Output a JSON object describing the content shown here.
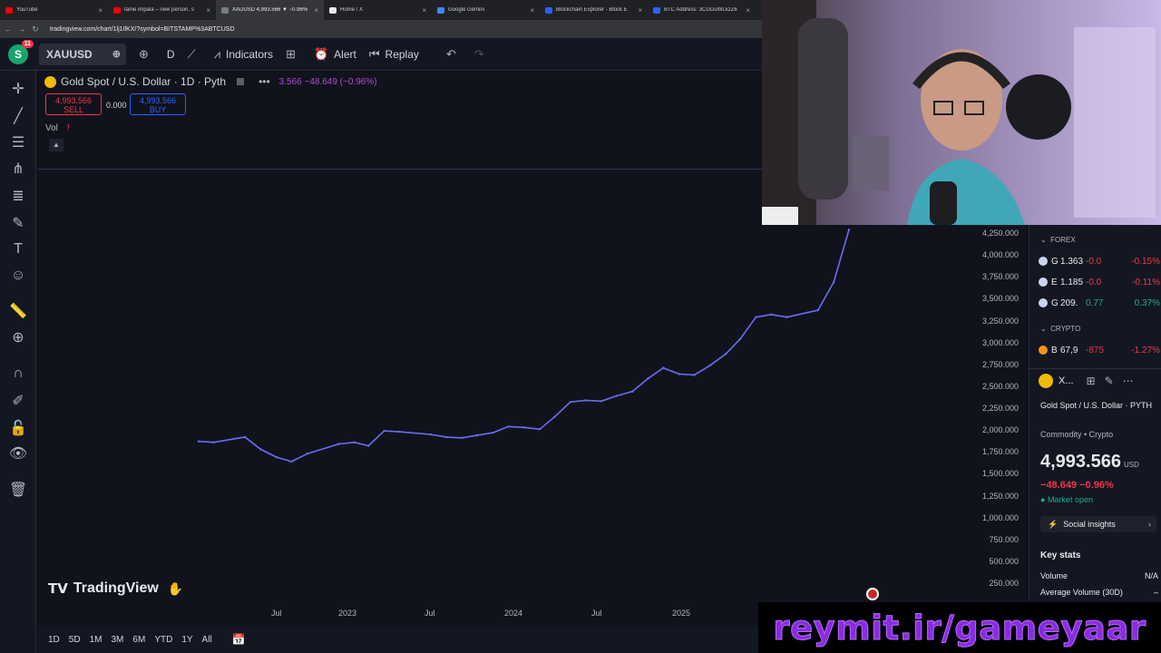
{
  "browser": {
    "tabs": [
      {
        "title": "YouTube",
        "color": "#ff0000",
        "active": false
      },
      {
        "title": "tame impala – new person, s",
        "color": "#ff0000",
        "active": false
      },
      {
        "title": "XAUUSD 4,993.566 ▼ −0.96%",
        "color": "#787b86",
        "active": true
      },
      {
        "title": "Home / X",
        "color": "#e8eaed",
        "active": false
      },
      {
        "title": "Google Gemini",
        "color": "#4285f4",
        "active": false
      },
      {
        "title": "Blockchain Explorer - Block E",
        "color": "#2962ff",
        "active": false
      },
      {
        "title": "BTC Address: 3CGDuWLkzZ6",
        "color": "#2962ff",
        "active": false
      }
    ],
    "url": "tradingview.com/chart/1lj1IlKX/?symbol=BITSTAMP%3ABTCUSD"
  },
  "toolbar": {
    "avatar_letter": "S",
    "notif_count": "11",
    "symbol": "XAUUSD",
    "interval": "D",
    "indicators_label": "Indicators",
    "alert_label": "Alert",
    "replay_label": "Replay"
  },
  "legend": {
    "title": "Gold Spot / U.S. Dollar · 1D · Pyth",
    "change": "3.566  −48.649 (−0.96%)",
    "sell_price": "4,993.566",
    "sell_label": "SELL",
    "spread": "0.000",
    "buy_price": "4,993.566",
    "buy_label": "BUY",
    "vol_label": "Vol",
    "vol_warning": "!"
  },
  "price_axis": [
    "4,250.000",
    "4,000.000",
    "3,750.000",
    "3,500.000",
    "3,250.000",
    "3,000.000",
    "2,750.000",
    "2,500.000",
    "2,250.000",
    "2,000.000",
    "1,750.000",
    "1,500.000",
    "1,250.000",
    "1,000.000",
    "750.000",
    "500.000",
    "250.000"
  ],
  "time_axis": [
    "Jul",
    "2023",
    "Jul",
    "2024",
    "Jul",
    "2025"
  ],
  "watermark": "TradingView",
  "ranges": [
    "1D",
    "5D",
    "1M",
    "3M",
    "6M",
    "YTD",
    "1Y",
    "All"
  ],
  "chart_data": {
    "type": "line",
    "title": "Gold Spot / U.S. Dollar · 1D · Pyth",
    "xlabel": "",
    "ylabel": "",
    "ylim": [
      250,
      4250
    ],
    "x": [
      "2022-04",
      "2022-05",
      "2022-07",
      "2022-08",
      "2022-09",
      "2022-10",
      "2022-11",
      "2023-01",
      "2023-02",
      "2023-03",
      "2023-04",
      "2023-05",
      "2023-07",
      "2023-08",
      "2023-09",
      "2023-10",
      "2023-11",
      "2023-12",
      "2024-01",
      "2024-02",
      "2024-03",
      "2024-04",
      "2024-05",
      "2024-06",
      "2024-07",
      "2024-08",
      "2024-09",
      "2024-10",
      "2024-11",
      "2024-12",
      "2025-01",
      "2025-02",
      "2025-03",
      "2025-04",
      "2025-05",
      "2025-06",
      "2025-08",
      "2025-09",
      "2025-10"
    ],
    "series": [
      {
        "values": [
          1880,
          1870,
          1930,
          1790,
          1700,
          1650,
          1740,
          1850,
          1870,
          1830,
          2000,
          1990,
          1960,
          1930,
          1920,
          1950,
          1980,
          2050,
          2040,
          2020,
          2160,
          2330,
          2350,
          2340,
          2400,
          2450,
          2600,
          2720,
          2650,
          2640,
          2750,
          2880,
          3050,
          3300,
          3330,
          3300,
          3380,
          3700,
          4300
        ]
      }
    ],
    "line_color": "#6a6ef5"
  },
  "right_panel": {
    "forex_label": "FOREX",
    "forex": [
      {
        "sym": "G",
        "price": "1.363",
        "chg": "-0.0",
        "pct": "-0.15%",
        "up": false
      },
      {
        "sym": "E",
        "price": "1.185",
        "chg": "-0.0",
        "pct": "-0.11%",
        "up": false
      },
      {
        "sym": "G",
        "price": "209.",
        "chg": "0.77",
        "pct": "0.37%",
        "up": true
      }
    ],
    "crypto_label": "CRYPTO",
    "crypto": [
      {
        "sym": "B",
        "price": "67,9",
        "chg": "-875",
        "pct": "-1.27%",
        "up": false
      }
    ],
    "detail_sym": "X...",
    "detail_name": "Gold Spot / U.S. Dollar · PYTH",
    "detail_category": "Commodity • Crypto",
    "detail_price": "4,993.566",
    "detail_unit": "USD",
    "detail_change": "−48.649 −0.96%",
    "market_status": "Market open",
    "social_label": "Social insights",
    "key_stats_label": "Key stats",
    "stats": [
      {
        "k": "Volume",
        "v": "N/A"
      },
      {
        "k": "Average Volume (30D)",
        "v": "–"
      }
    ]
  },
  "banner": "reymit.ir/gameyaar"
}
